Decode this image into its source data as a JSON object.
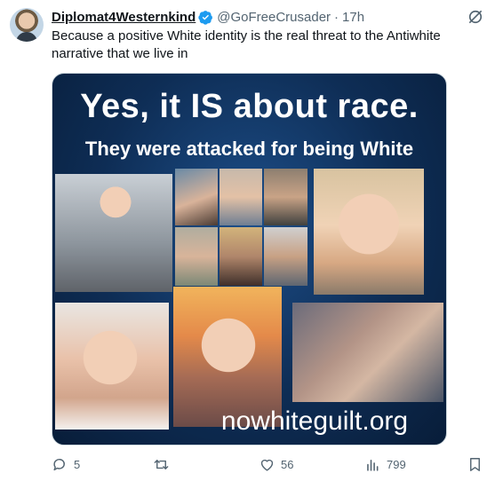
{
  "post": {
    "display_name": "Diplomat4Westernkind",
    "handle": "@GoFreeCrusader",
    "separator": "·",
    "time": "17h",
    "text": "Because a positive White identity is the real threat to the Antiwhite narrative that we live in"
  },
  "media": {
    "title": "Yes, it IS about race.",
    "subtitle": "They were attacked for being White",
    "url_text": "nowhiteguilt.org"
  },
  "actions": {
    "replies": "5",
    "reposts": "",
    "likes": "56",
    "views": "799"
  },
  "colors": {
    "verified": "#1d9bf0",
    "secondary_text": "#536471",
    "image_background": "#0e2d55"
  },
  "icons": [
    "verified-badge-icon",
    "grok-icon",
    "reply-icon",
    "repost-icon",
    "like-icon",
    "views-icon",
    "bookmark-icon"
  ]
}
